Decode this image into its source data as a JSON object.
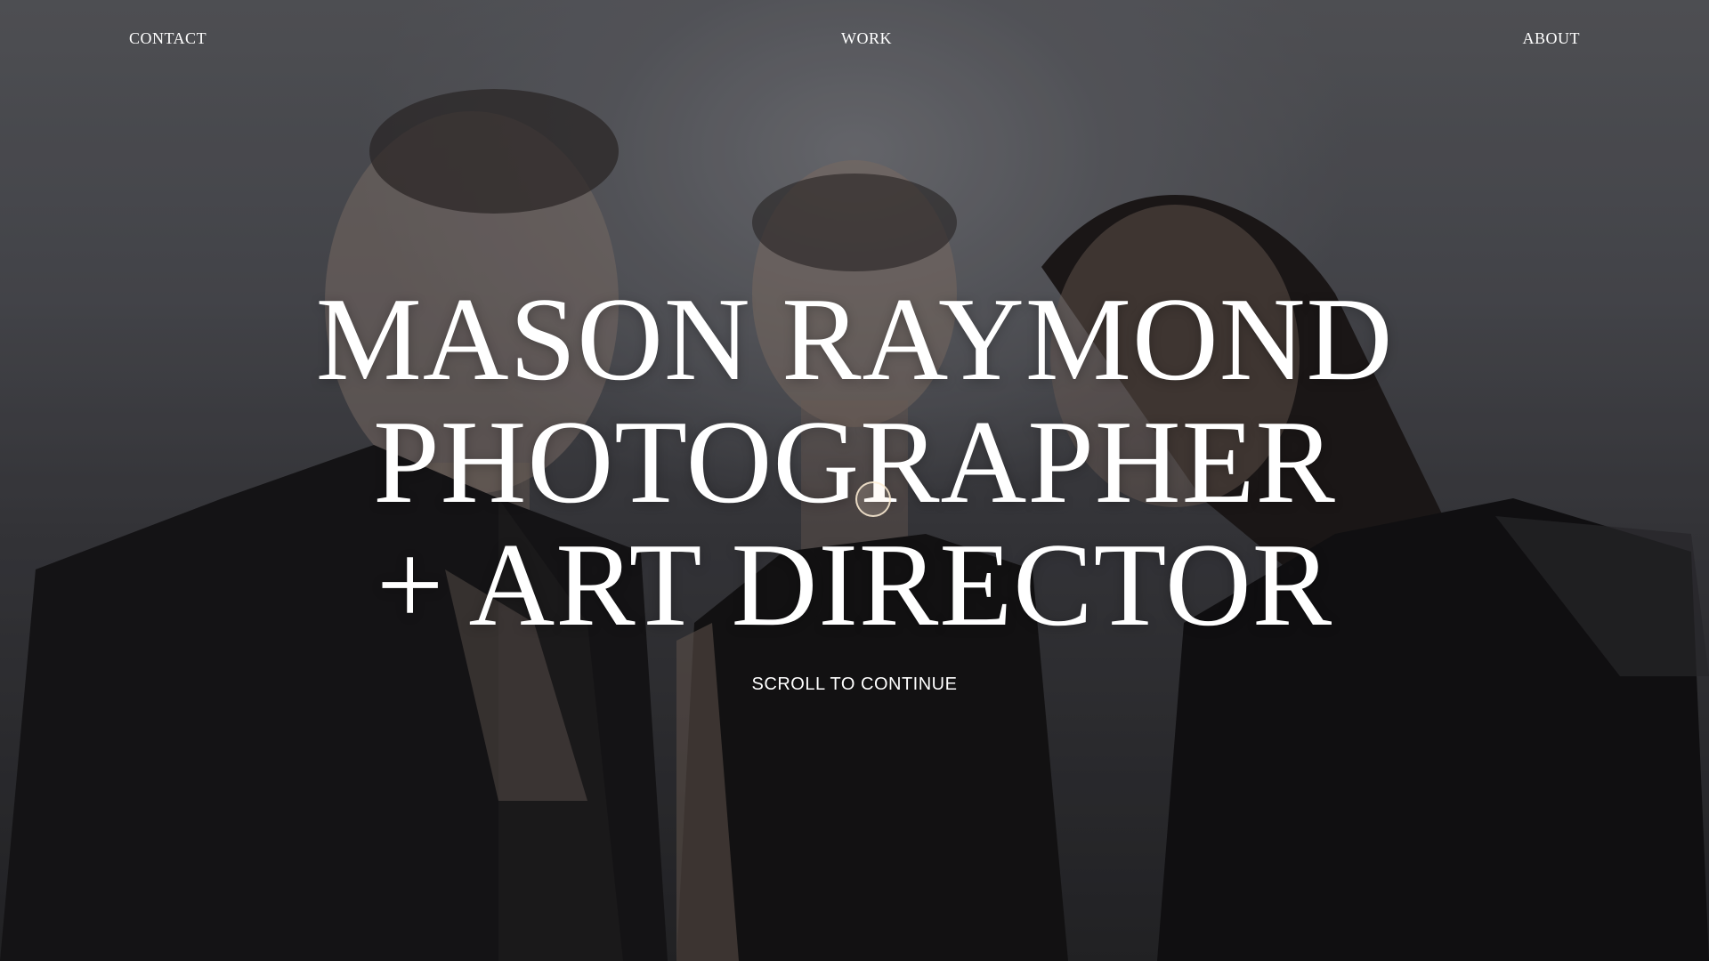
{
  "nav": {
    "contact_label": "CONTACT",
    "work_label": "WORK",
    "about_label": "ABOUT"
  },
  "hero": {
    "headline_line1": "MASON RAYMOND",
    "headline_line2": "PHOTOGRAPHER",
    "headline_line3": "+ ART DIRECTOR",
    "scroll_label": "SCROLL TO CONTINUE"
  },
  "colors": {
    "text": "#ffffff",
    "background": "#2a2a2d",
    "cursor_ring": "#fff0d7"
  },
  "icons": {
    "cursor": "circle-cursor-icon"
  }
}
